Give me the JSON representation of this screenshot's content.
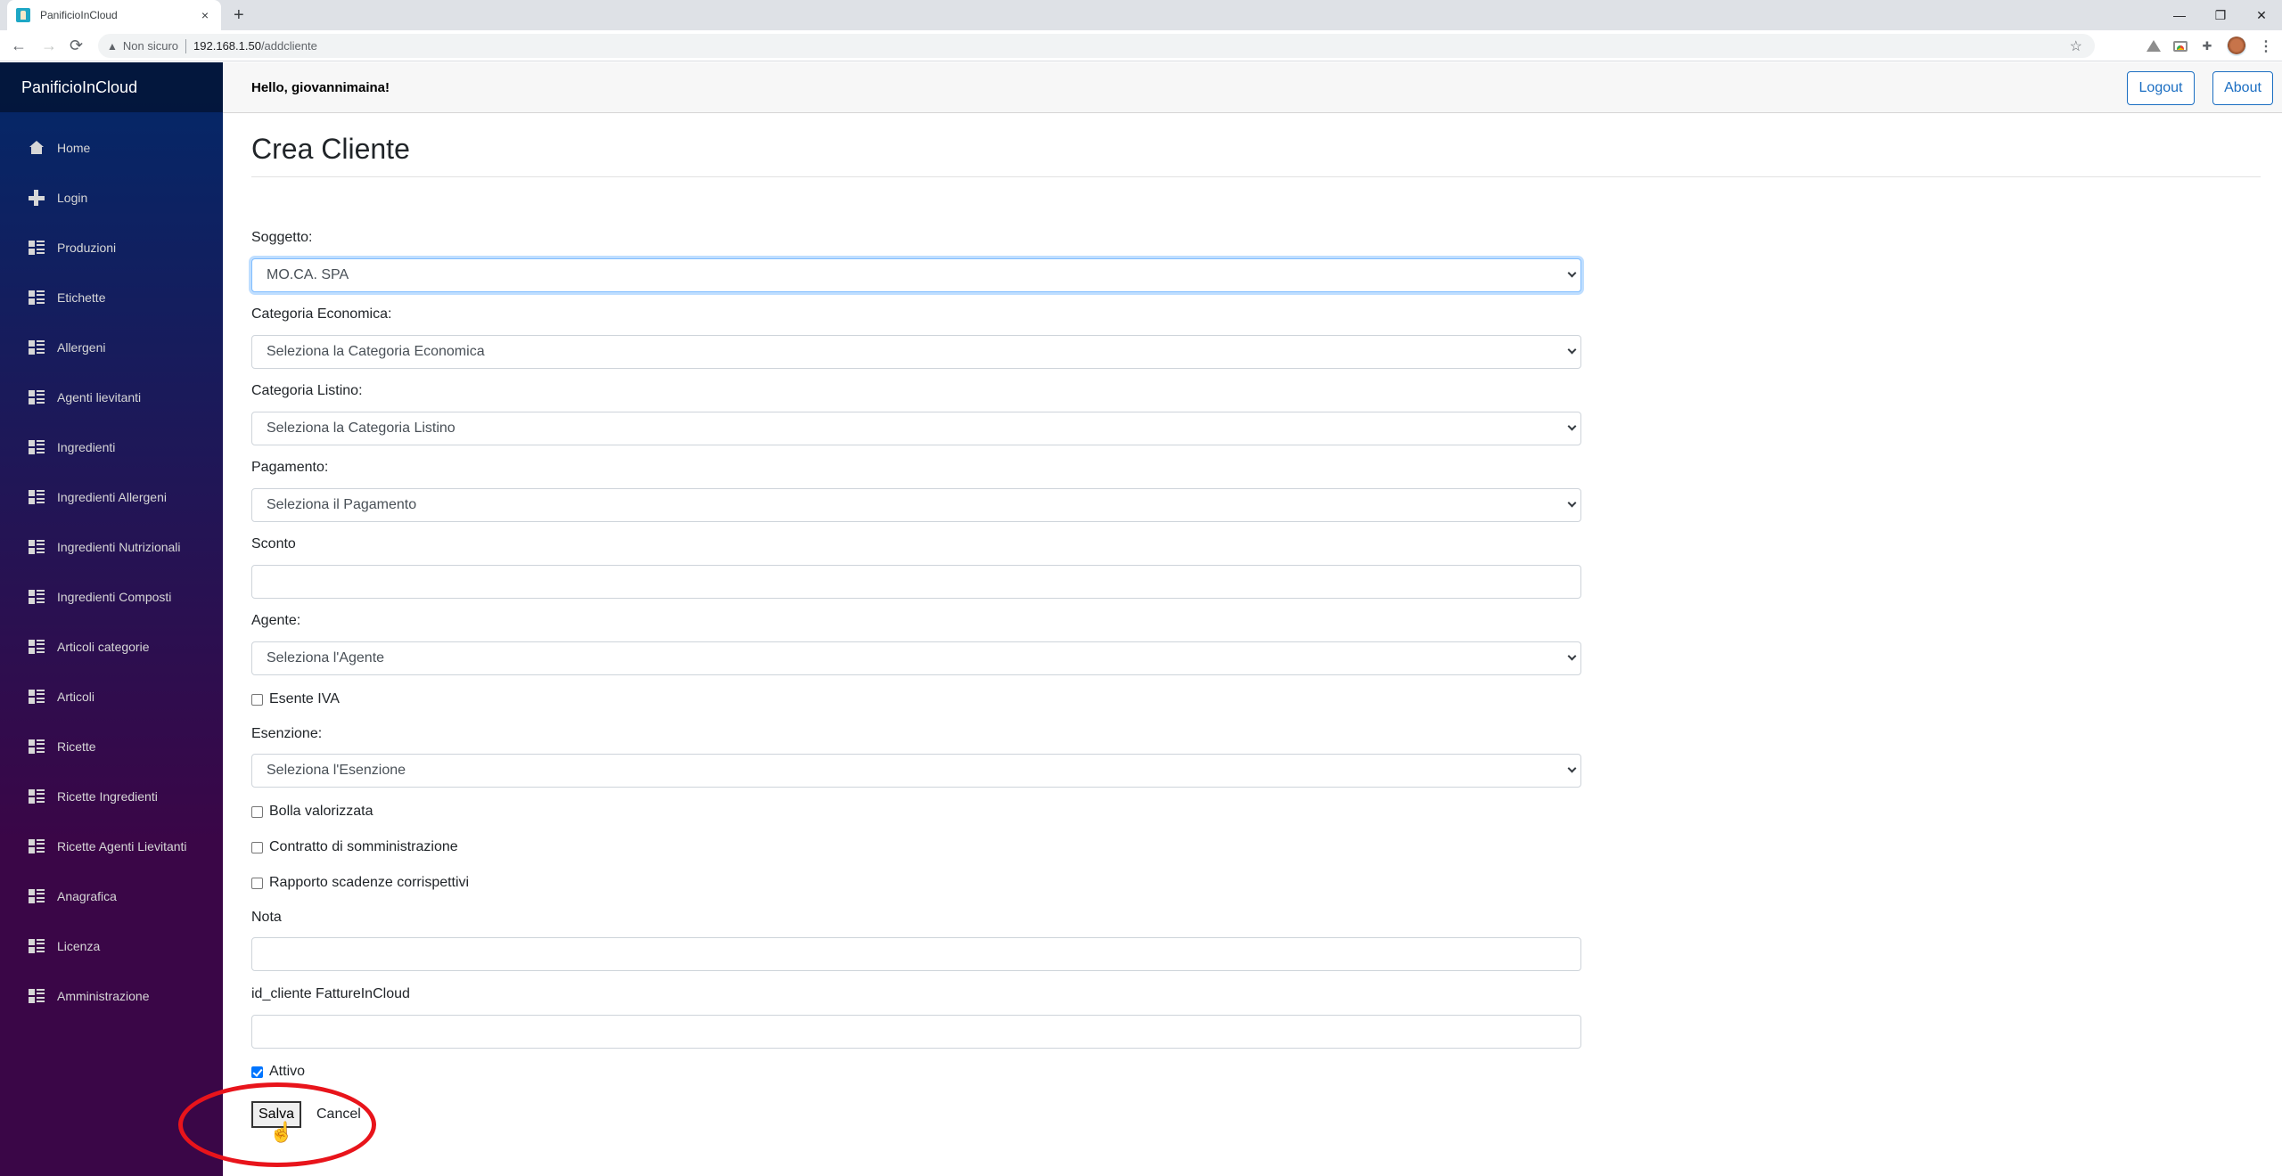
{
  "browser": {
    "tab_title": "PanificioInCloud",
    "tab_close": "×",
    "new_tab": "+",
    "window_controls": {
      "minimize": "—",
      "restore": "❐",
      "close": "✕"
    },
    "nav": {
      "back": "←",
      "forward": "→",
      "reload": "⟳"
    },
    "security_icon": "▲",
    "security_label": "Non sicuro",
    "url_host": "192.168.1.50",
    "url_path": "/addcliente",
    "bookmark_icon": "☆",
    "menu_icon": "⋮"
  },
  "sidebar": {
    "brand": "PanificioInCloud",
    "items": [
      {
        "label": "Home",
        "icon": "home"
      },
      {
        "label": "Login",
        "icon": "plus"
      },
      {
        "label": "Produzioni",
        "icon": "list"
      },
      {
        "label": "Etichette",
        "icon": "list"
      },
      {
        "label": "Allergeni",
        "icon": "list"
      },
      {
        "label": "Agenti lievitanti",
        "icon": "list"
      },
      {
        "label": "Ingredienti",
        "icon": "list"
      },
      {
        "label": "Ingredienti Allergeni",
        "icon": "list"
      },
      {
        "label": "Ingredienti Nutrizionali",
        "icon": "list"
      },
      {
        "label": "Ingredienti Composti",
        "icon": "list"
      },
      {
        "label": "Articoli categorie",
        "icon": "list"
      },
      {
        "label": "Articoli",
        "icon": "list"
      },
      {
        "label": "Ricette",
        "icon": "list"
      },
      {
        "label": "Ricette Ingredienti",
        "icon": "list"
      },
      {
        "label": "Ricette Agenti Lievitanti",
        "icon": "list"
      },
      {
        "label": "Anagrafica",
        "icon": "list"
      },
      {
        "label": "Licenza",
        "icon": "list"
      },
      {
        "label": "Amministrazione",
        "icon": "list"
      }
    ]
  },
  "header": {
    "greeting": "Hello, giovannimaina!",
    "logout_label": "Logout",
    "about_label": "About"
  },
  "form": {
    "title": "Crea Cliente",
    "soggetto": {
      "label": "Soggetto:",
      "value": "MO.CA. SPA"
    },
    "categoria_economica": {
      "label": "Categoria Economica:",
      "value": "Seleziona la Categoria Economica"
    },
    "categoria_listino": {
      "label": "Categoria Listino:",
      "value": "Seleziona la Categoria Listino"
    },
    "pagamento": {
      "label": "Pagamento:",
      "value": "Seleziona il Pagamento"
    },
    "sconto": {
      "label": "Sconto",
      "value": ""
    },
    "agente": {
      "label": "Agente:",
      "value": "Seleziona l'Agente"
    },
    "esente_iva": {
      "label": "Esente IVA",
      "checked": false
    },
    "esenzione": {
      "label": "Esenzione:",
      "value": "Seleziona l'Esenzione"
    },
    "bolla_valorizzata": {
      "label": "Bolla valorizzata",
      "checked": false
    },
    "contratto_somministrazione": {
      "label": "Contratto di somministrazione",
      "checked": false
    },
    "rapporto_scadenze": {
      "label": "Rapporto scadenze corrispettivi",
      "checked": false
    },
    "nota": {
      "label": "Nota",
      "value": ""
    },
    "id_cliente_fic": {
      "label": "id_cliente FattureInCloud",
      "value": ""
    },
    "attivo": {
      "label": "Attivo",
      "checked": true
    },
    "save_label": "Salva",
    "cancel_label": "Cancel"
  },
  "colors": {
    "sidebar_top": "#052767",
    "sidebar_bottom": "#3a0647",
    "accent": "#1b6ec2",
    "annotation": "#e8141b"
  }
}
